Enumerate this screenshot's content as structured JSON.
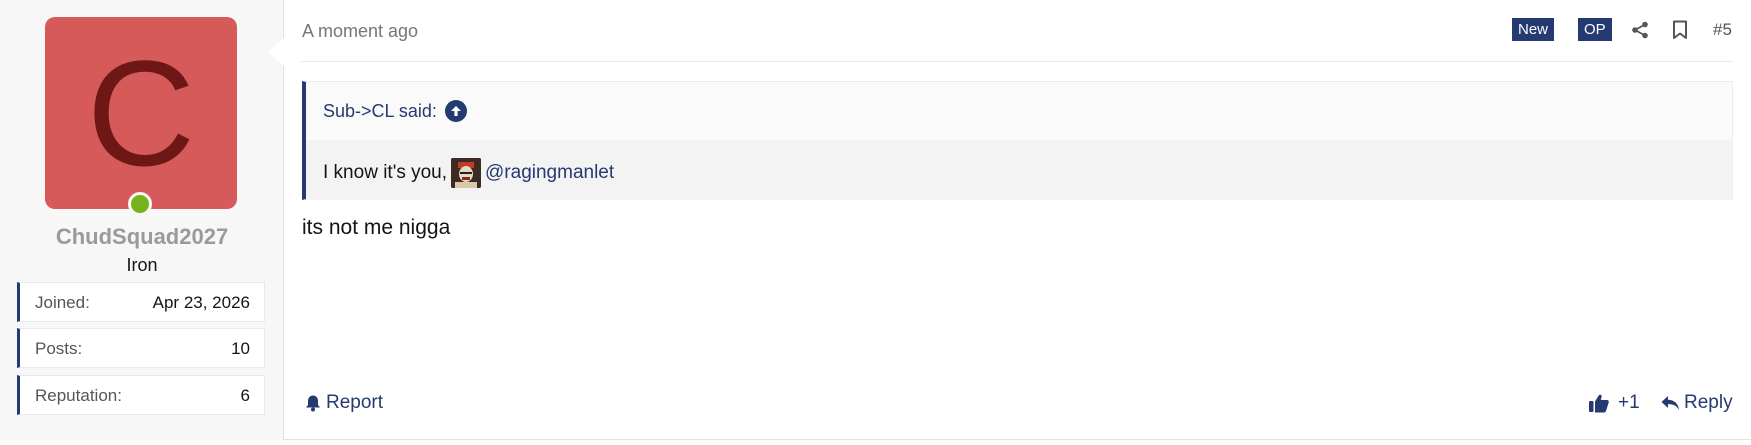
{
  "user": {
    "avatar_letter": "C",
    "avatar_color": "#d65a5a",
    "avatar_letter_color": "#6e1717",
    "online_color": "#78b21a",
    "name": "ChudSquad2027",
    "title": "Iron",
    "stats": [
      {
        "label": "Joined:",
        "value": "Apr 23, 2026"
      },
      {
        "label": "Posts:",
        "value": "10"
      },
      {
        "label": "Reputation:",
        "value": "6"
      }
    ]
  },
  "post": {
    "timestamp": "A moment ago",
    "badges": {
      "new": "New",
      "op": "OP"
    },
    "post_number": "#5",
    "quote": {
      "author_line": "Sub->CL said:",
      "text": "I know it's you,",
      "mention": "@ragingmanlet"
    },
    "message": "its not me nigga",
    "actions": {
      "report": "Report",
      "like": "+1",
      "reply": "Reply"
    }
  },
  "colors": {
    "accent": "#263a72",
    "sidebar_bg": "#f7f7f7"
  },
  "icons": {
    "share": "share-icon",
    "bookmark": "bookmark-icon",
    "quote_up": "arrow-up-circle-icon",
    "report": "bell-icon",
    "like": "thumbs-up-icon",
    "reply": "reply-icon"
  }
}
